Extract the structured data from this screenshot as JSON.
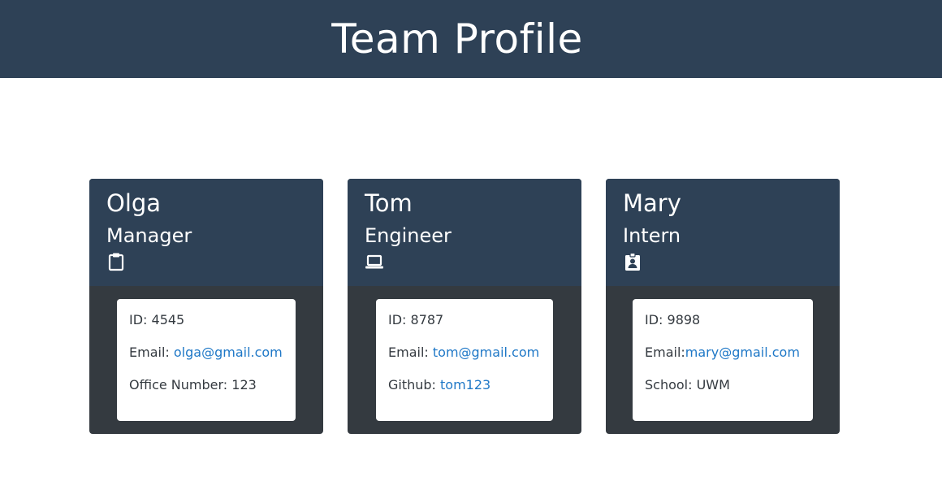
{
  "header": {
    "title": "Team Profile"
  },
  "members": [
    {
      "name": "Olga",
      "role": "Manager",
      "icon": "clipboard-icon",
      "id_label": "ID: ",
      "id": "4545",
      "email_label": "Email: ",
      "email": "olga@gmail.com",
      "extra_label": "Office Number: ",
      "extra_value": "123"
    },
    {
      "name": "Tom",
      "role": "Engineer",
      "icon": "laptop-icon",
      "id_label": "ID: ",
      "id": "8787",
      "email_label": "Email: ",
      "email": "tom@gmail.com",
      "extra_label": "Github: ",
      "extra_value": "tom123"
    },
    {
      "name": "Mary",
      "role": "Intern",
      "icon": "id-badge-icon",
      "id_label": "ID: ",
      "id": "9898",
      "email_label": "Email:",
      "email": "mary@gmail.com",
      "extra_label": "School: ",
      "extra_value": "UWM"
    }
  ],
  "colors": {
    "header_bg": "#2e4156",
    "card_bottom_bg": "#343a40",
    "link": "#1f78c7"
  }
}
